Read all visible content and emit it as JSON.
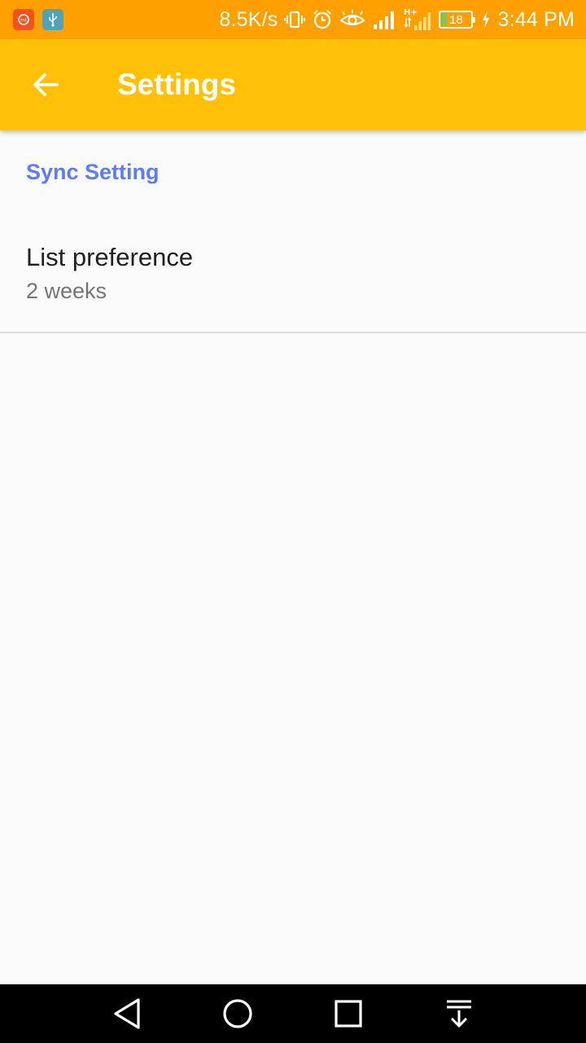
{
  "status_bar": {
    "network_speed": "8.5K/s",
    "network_type": "H+",
    "battery_level": "18",
    "time": "3:44 PM",
    "icons": [
      "mi-app-icon",
      "usb-icon",
      "vibrate-icon",
      "alarm-icon",
      "eye-comfort-icon",
      "signal-icon",
      "signal-h-plus-icon",
      "battery-icon",
      "charging-icon"
    ]
  },
  "app_bar": {
    "title": "Settings",
    "back_icon": "arrow-back-icon"
  },
  "settings": {
    "category_title": "Sync Setting",
    "items": [
      {
        "title": "List preference",
        "summary": "2 weeks"
      }
    ]
  },
  "nav_bar": {
    "icons": [
      "back-triangle-icon",
      "home-circle-icon",
      "recents-square-icon",
      "notification-pull-icon"
    ]
  },
  "colors": {
    "status_bar": "#ffa000",
    "app_bar": "#ffc107",
    "accent": "#5c7cfa",
    "background": "#fafafa"
  }
}
